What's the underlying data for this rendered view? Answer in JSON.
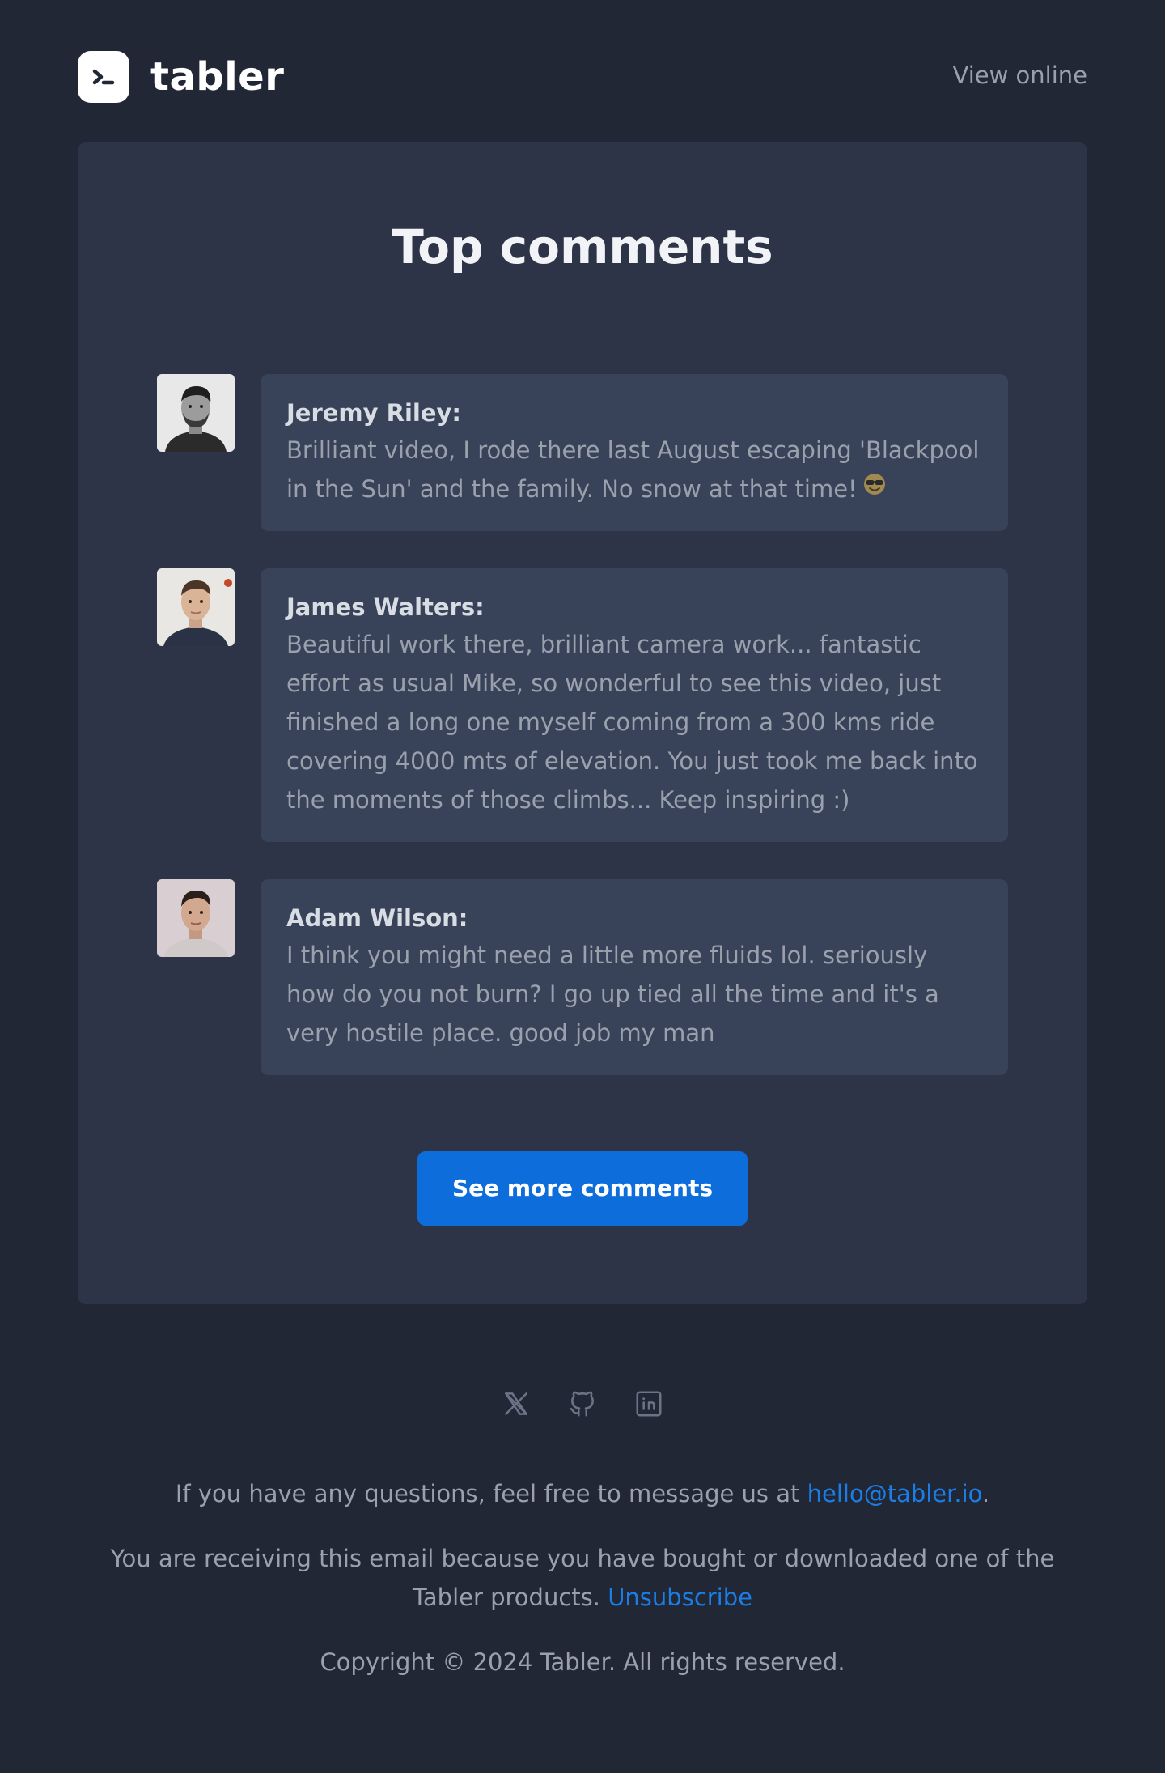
{
  "header": {
    "brand_name": "tabler",
    "view_online": "View online"
  },
  "card": {
    "title": "Top comments",
    "comments": [
      {
        "author": "Jeremy Riley:",
        "text": "Brilliant video, I rode there last August escaping 'Blackpool in the Sun' and the family. No snow at that time!",
        "emoji": "smiling-face-with-sunglasses-icon"
      },
      {
        "author": "James Walters:",
        "text": "Beautiful work there, brilliant camera work... fantastic effort as usual Mike, so wonderful to see this video, just finished a long one myself coming from a 300 kms ride covering 4000 mts of elevation. You just took me back into the moments of those climbs... Keep inspiring :)"
      },
      {
        "author": "Adam Wilson:",
        "text": "I think you might need a little more fluids lol. seriously how do you not burn? I go up tied all the time and it's a very hostile place. good job my man"
      }
    ],
    "button_label": "See more comments"
  },
  "footer": {
    "social_icons": [
      "x-icon",
      "github-icon",
      "linkedin-icon"
    ],
    "contact_prefix": "If you have any questions, feel free to message us at ",
    "contact_email": "hello@tabler.io",
    "contact_suffix": ".",
    "receiving_text": "You are receiving this email because you have bought or downloaded one of the Tabler products.",
    "unsubscribe_label": "Unsubscribe",
    "copyright": "Copyright © 2024 Tabler. All rights reserved."
  },
  "colors": {
    "page_background": "#222736",
    "card_background": "#2d3447",
    "bubble_background": "#38435a",
    "accent": "#0d6edb",
    "link": "#1a7ee6",
    "muted_text": "#9aa0ac"
  }
}
